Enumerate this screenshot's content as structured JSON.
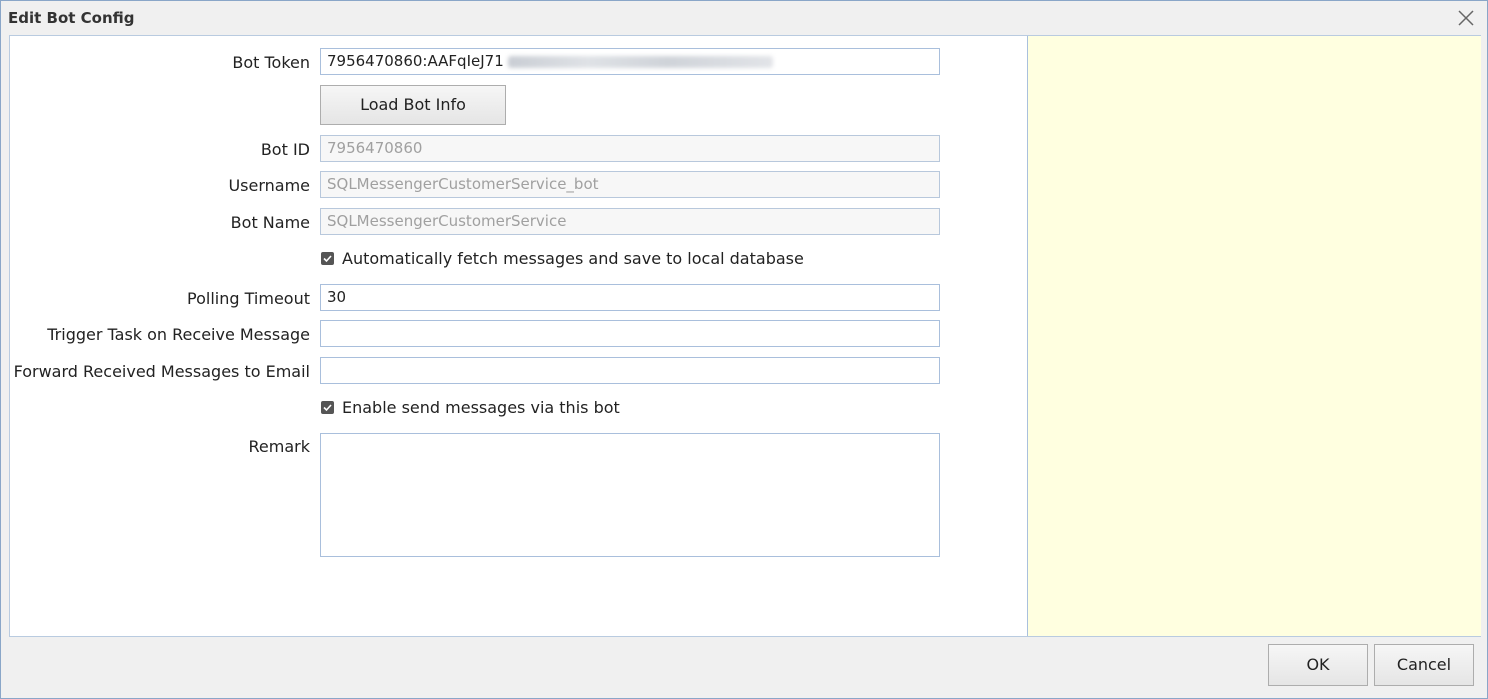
{
  "window": {
    "title": "Edit Bot Config",
    "close_icon": "close-icon"
  },
  "form": {
    "bot_token": {
      "label": "Bot Token",
      "value": "7956470860:AAFqIeJ71"
    },
    "load_button_label": "Load Bot Info",
    "bot_id": {
      "label": "Bot ID",
      "value": "7956470860"
    },
    "username": {
      "label": "Username",
      "value": "SQLMessengerCustomerService_bot"
    },
    "bot_name": {
      "label": "Bot Name",
      "value": "SQLMessengerCustomerService"
    },
    "auto_fetch": {
      "label": "Automatically fetch messages and save to local database",
      "checked": true
    },
    "polling_timeout": {
      "label": "Polling Timeout",
      "value": "30"
    },
    "trigger_task": {
      "label": "Trigger Task on Receive Message",
      "value": ""
    },
    "forward_email": {
      "label": "Forward Received Messages to Email",
      "value": ""
    },
    "enable_send": {
      "label": "Enable send messages via this bot",
      "checked": true
    },
    "remark": {
      "label": "Remark",
      "value": ""
    }
  },
  "footer": {
    "ok_label": "OK",
    "cancel_label": "Cancel"
  },
  "colors": {
    "info_panel_bg": "#ffffe0",
    "border_accent": "#a9bfdc"
  }
}
